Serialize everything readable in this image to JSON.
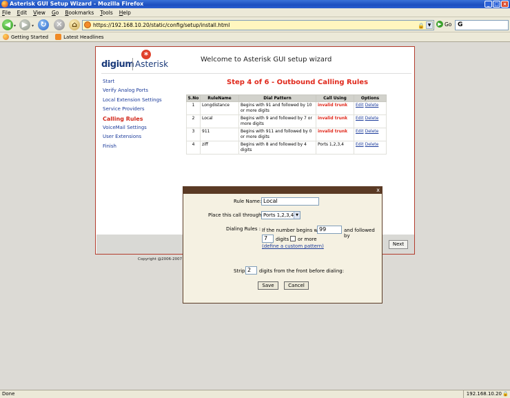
{
  "window": {
    "title": "Asterisk GUI Setup Wizard - Mozilla Firefox"
  },
  "menu": [
    "File",
    "Edit",
    "View",
    "Go",
    "Bookmarks",
    "Tools",
    "Help"
  ],
  "nav": {
    "url": "https://192.168.10.20/static/config/setup/install.html",
    "go_label": "Go",
    "search_value": "G"
  },
  "bookmarks": [
    "Getting Started",
    "Latest Headlines"
  ],
  "wizard": {
    "logo_left": "digium",
    "logo_right": "Asterisk",
    "welcome": "Welcome to Asterisk GUI setup wizard",
    "steps": [
      "Start",
      "Verify Analog Ports",
      "Local Extension Settings",
      "Service Providers",
      "Calling Rules",
      "VoiceMail Settings",
      "User Extensions",
      "Finish"
    ],
    "active_step": "Calling Rules",
    "step_title": "Step 4 of 6  - Outbound Calling Rules",
    "table": {
      "headers": [
        "S.No",
        "RuleName",
        "Dial Pattern",
        "Call Using",
        "Options"
      ],
      "rows": [
        {
          "sno": "1",
          "name": "Longdistance",
          "pattern": "Begins with 91 and followed by 10 or more digits",
          "call_using": "invalid trunk",
          "edit": "Edit",
          "delete": "Delete"
        },
        {
          "sno": "2",
          "name": "Local",
          "pattern": "Begins with 9 and followed by 7 or more digits",
          "call_using": "invalid trunk",
          "edit": "Edit",
          "delete": "Delete"
        },
        {
          "sno": "3",
          "name": "911",
          "pattern": "Begins with 911 and followed by 0 or more digits",
          "call_using": "invalid trunk",
          "edit": "Edit",
          "delete": "Delete"
        },
        {
          "sno": "4",
          "name": "ziff",
          "pattern": "Begins with 8 and followed by 4 digits",
          "call_using": "Ports 1,2,3,4",
          "edit": "Edit",
          "delete": "Delete"
        }
      ]
    },
    "next_label": "Next",
    "copyright": "Copyright @2006-2007 Digi"
  },
  "dialog": {
    "close_label": "x",
    "rule_name_label": "Rule Name:",
    "rule_name_value": "Local",
    "place_call_label": "Place this call through :",
    "place_call_value": "Ports 1,2,3,4",
    "dialing_rules_label": "Dialing Rules :",
    "begins_with_text": "If the number begins with",
    "begins_with_value": "99",
    "followed_by_text": "and followed by",
    "digits_value": "7",
    "digits_text": "digits",
    "or_more_text": "or more",
    "custom_pattern_link": "(define a custom pattern)",
    "strip_label": "Strip",
    "strip_value": "2",
    "strip_text": "digits from the front before dialing:",
    "save_label": "Save",
    "cancel_label": "Cancel"
  },
  "status": {
    "left": "Done",
    "right": "192.168.10.20"
  }
}
